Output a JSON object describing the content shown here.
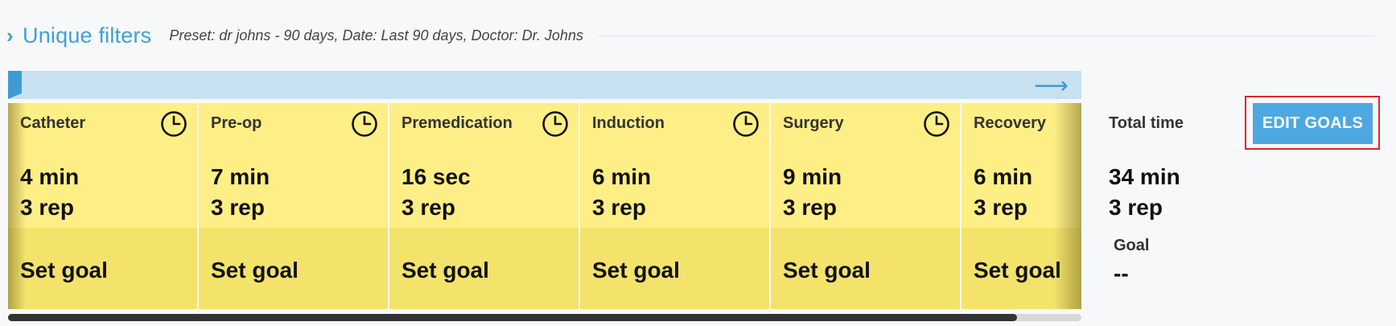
{
  "filters": {
    "title": "Unique filters",
    "summary": "Preset: dr johns - 90 days, Date: Last 90 days, Doctor: Dr. Johns"
  },
  "scrollbar": {
    "visible_fraction": 0.94
  },
  "stages": [
    {
      "name": "Catheter",
      "time": "4 min",
      "reps": "3 rep",
      "goal": "Set goal"
    },
    {
      "name": "Pre-op",
      "time": "7 min",
      "reps": "3 rep",
      "goal": "Set goal"
    },
    {
      "name": "Premedication",
      "time": "16 sec",
      "reps": "3 rep",
      "goal": "Set goal"
    },
    {
      "name": "Induction",
      "time": "6 min",
      "reps": "3 rep",
      "goal": "Set goal"
    },
    {
      "name": "Surgery",
      "time": "9 min",
      "reps": "3 rep",
      "goal": "Set goal"
    },
    {
      "name": "Recovery",
      "time": "6 min",
      "reps": "3 rep",
      "goal": "Set goal"
    }
  ],
  "totals": {
    "label": "Total time",
    "time": "34 min",
    "reps": "3 rep",
    "goal_label": "Goal",
    "goal_value": "--"
  },
  "actions": {
    "edit_goals": "EDIT GOALS"
  },
  "colors": {
    "accent": "#3fa0d8",
    "stage_bg": "#fdee85",
    "stage_goal_bg": "#f3e36b",
    "highlight": "#e0242b"
  },
  "icons": {
    "filters_toggle": "chevron-right-icon",
    "stage_timer": "clock-icon",
    "scroll_next": "arrow-right-icon"
  }
}
